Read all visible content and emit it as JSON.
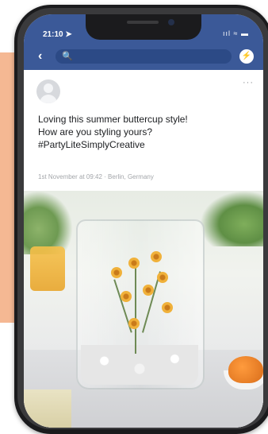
{
  "status_bar": {
    "time": "21:10 ➤",
    "icons": "ııl ≈ ▬"
  },
  "nav": {
    "back_glyph": "‹",
    "search_glyph": "🔍",
    "messenger_glyph": "⚡"
  },
  "post": {
    "more_glyph": "···",
    "lines": [
      "Loving this summer buttercup style!",
      "How are you styling yours?",
      "#PartyLiteSimplyCreative"
    ],
    "meta": "1st November at 09:42 · Berlin, Germany"
  },
  "colors": {
    "facebook_blue": "#3b5998",
    "accent_peach": "#f5b893"
  }
}
